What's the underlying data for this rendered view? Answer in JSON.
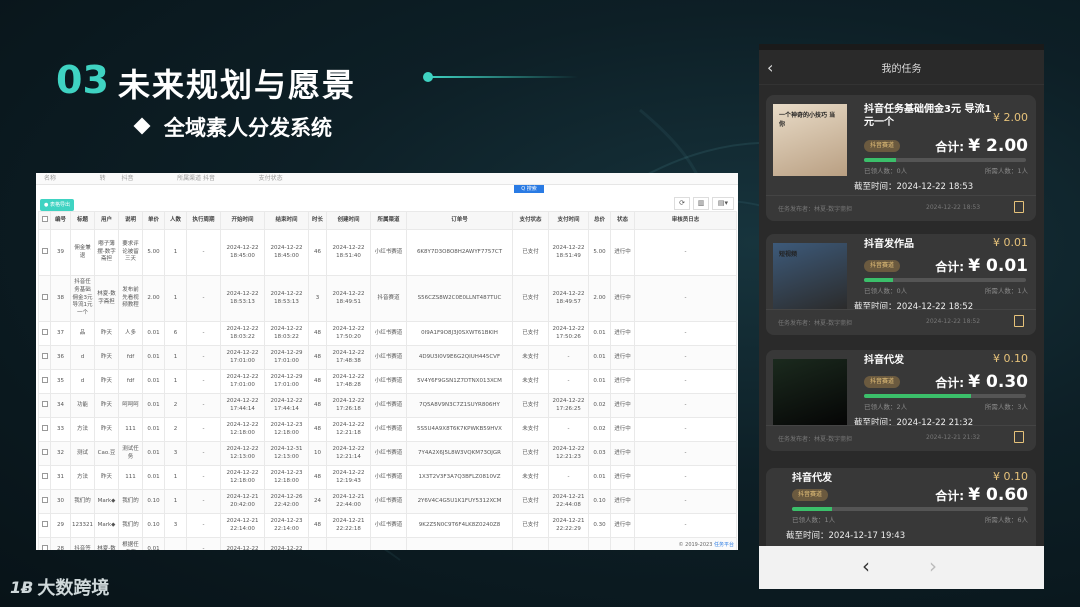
{
  "slide": {
    "section_number": "03",
    "section_title": "未来规划与愿景",
    "subtitle": "全域素人分发系统",
    "logo_text": "大数跨境",
    "logo_mark": "1Ƀ",
    "accent_color": "#3fd3c2"
  },
  "admin": {
    "topbar": "名称 　　 　　 　　 转 　　 抖音 　　 　　 　　 所属渠道 抖音 　　 　　 　　 支付状态 　　 　　 　　",
    "export_label": "● 表格导出",
    "search_label": "Q 搜索",
    "tool_refresh": "⟳",
    "tool_columns": "▥",
    "tool_export": "▤▾",
    "footer_text": "© 2019-2023",
    "footer_link": "任务平台",
    "columns": [
      "编号",
      "标题",
      "用户",
      "说明",
      "单价",
      "人数",
      "执行周期",
      "开始时间",
      "结束时间",
      "时长",
      "创建时间",
      "所属渠道",
      "订单号",
      "支付状态",
      "支付时间",
      "总价",
      "状态",
      "审核员日志"
    ],
    "rows": [
      {
        "tall": true,
        "cells": [
          "39",
          "佣金兼退",
          "嘟子薄摆-数字斋担",
          "要求评论被留三天",
          "5.00",
          "1",
          "-",
          "2024-12-22 18:45:00",
          "2024-12-22 18:45:00",
          "46",
          "2024-12-22 18:51:40",
          "小红书赛道",
          "6K8Y7D3O8O8H2AWYF7757CT",
          "已支付",
          "2024-12-22 18:51:49",
          "5.00",
          "进行中",
          "-"
        ]
      },
      {
        "tall": true,
        "cells": [
          "38",
          "抖音任务基础佣金3元导流1元一个",
          "林夏-数字斋担",
          "发布前先看视频教程",
          "2.00",
          "1",
          "-",
          "2024-12-22 18:53:13",
          "2024-12-22 18:53:13",
          "3",
          "2024-12-22 18:49:51",
          "抖音赛道",
          "S56CZS8W2C0E0LLNT487TUC",
          "已支付",
          "2024-12-22 18:49:57",
          "2.00",
          "进行中",
          "-"
        ]
      },
      {
        "tall": false,
        "cells": [
          "37",
          "品",
          "昨天",
          "人多",
          "0.01",
          "6",
          "-",
          "2024-12-22 18:03:22",
          "2024-12-22 18:03:22",
          "48",
          "2024-12-22 17:50:20",
          "小红书赛道",
          "0I9A1F9O8J3J0SXWT61BKIH",
          "已支付",
          "2024-12-22 17:50:26",
          "0.01",
          "进行中",
          "-"
        ]
      },
      {
        "tall": false,
        "cells": [
          "36",
          "d",
          "昨天",
          "fdf",
          "0.01",
          "1",
          "-",
          "2024-12-22 17:01:00",
          "2024-12-29 17:01:00",
          "48",
          "2024-12-22 17:48:38",
          "小红书赛道",
          "4D9U3I0V9E6G2QIUH445CVF",
          "未支付",
          "-",
          "0.01",
          "进行中",
          "-"
        ]
      },
      {
        "tall": false,
        "cells": [
          "35",
          "d",
          "昨天",
          "fdf",
          "0.01",
          "1",
          "-",
          "2024-12-22 17:01:00",
          "2024-12-29 17:01:00",
          "48",
          "2024-12-22 17:48:28",
          "小红书赛道",
          "5V4Y6F9GSN1Z7DTNX013XCM",
          "未支付",
          "-",
          "0.01",
          "进行中",
          "-"
        ]
      },
      {
        "tall": false,
        "cells": [
          "34",
          "功能",
          "昨天",
          "呵呵呵",
          "0.01",
          "2",
          "-",
          "2024-12-22 17:44:14",
          "2024-12-22 17:44:14",
          "48",
          "2024-12-22 17:26:18",
          "小红书赛道",
          "7Q5A8V9N3C7Z1SUYR806HY",
          "已支付",
          "2024-12-22 17:26:25",
          "0.02",
          "进行中",
          "-"
        ]
      },
      {
        "tall": false,
        "cells": [
          "33",
          "方法",
          "昨天",
          "111",
          "0.01",
          "2",
          "-",
          "2024-12-22 12:18:00",
          "2024-12-23 12:18:00",
          "48",
          "2024-12-22 12:21:18",
          "小红书赛道",
          "5S5U4A9X8T6K7KPWKB59HVX",
          "未支付",
          "-",
          "0.02",
          "进行中",
          "-"
        ]
      },
      {
        "tall": false,
        "cells": [
          "32",
          "测试",
          "Cao.豆",
          "测试任务",
          "0.01",
          "3",
          "-",
          "2024-12-22 12:13:00",
          "2024-12-31 12:13:00",
          "10",
          "2024-12-22 12:21:14",
          "小红书赛道",
          "7Y4A2X6J5L8W3VQKM73OJGR",
          "已支付",
          "2024-12-22 12:21:23",
          "0.03",
          "进行中",
          "-"
        ]
      },
      {
        "tall": false,
        "cells": [
          "31",
          "方法",
          "昨天",
          "111",
          "0.01",
          "1",
          "-",
          "2024-12-22 12:18:00",
          "2024-12-23 12:18:00",
          "48",
          "2024-12-22 12:19:43",
          "小红书赛道",
          "1X3T2V3F3A7Q3BFLZ0810VZ",
          "未支付",
          "-",
          "0.01",
          "进行中",
          "-"
        ]
      },
      {
        "tall": false,
        "cells": [
          "30",
          "我们的",
          "Mark◆",
          "我们的",
          "0.10",
          "1",
          "-",
          "2024-12-21 20:42:00",
          "2024-12-26 22:42:00",
          "24",
          "2024-12-21 22:44:00",
          "小红书赛道",
          "2Y6V4C4G5U1K1FUY5312XCM",
          "已支付",
          "2024-12-21 22:44:08",
          "0.10",
          "进行中",
          "-"
        ]
      },
      {
        "tall": false,
        "cells": [
          "29",
          "123321",
          "Mark◆",
          "我们的",
          "0.10",
          "3",
          "-",
          "2024-12-21 22:14:00",
          "2024-12-23 22:14:00",
          "48",
          "2024-12-21 22:22:18",
          "小红书赛道",
          "9K2Z5N0C9T6F4LK8Z0240Z8",
          "已支付",
          "2024-12-21 22:22:29",
          "0.30",
          "进行中",
          "-"
        ]
      },
      {
        "tall": false,
        "cells": [
          "28",
          "抖音签",
          "林夏-数",
          "根据任务要",
          "0.01",
          "",
          "-",
          "2024-12-22",
          "2024-12-22",
          "",
          "",
          "",
          "",
          "",
          "",
          "",
          "",
          ""
        ]
      }
    ]
  },
  "phone": {
    "nav_title": "我的任务",
    "back_icon": "‹",
    "pager_prev": "‹",
    "pager_next": "›",
    "cards": [
      {
        "title": "抖音任务基础佣金3元 导流1元一个",
        "price": "¥ 2.00",
        "tag": "抖音赛道",
        "total_label": "合计:",
        "total": "¥ 2.00",
        "progress": 0.2,
        "joined": "已领人数：0人",
        "needed": "所需人数：1人",
        "deadline": "截至时间：2024-12-22 18:53",
        "publisher": "任务发布者：林夏-数字斋担",
        "published": "2024-12-22 18:53",
        "thumb_text": "一个神奇的小技巧 当你"
      },
      {
        "title": "抖音发作品",
        "price": "¥ 0.01",
        "tag": "抖音赛道",
        "total_label": "合计:",
        "total": "¥ 0.01",
        "progress": 0.18,
        "joined": "已领人数：0人",
        "needed": "所需人数：1人",
        "deadline": "截至时间：2024-12-22 18:52",
        "publisher": "任务发布者：林夏-数字斋担",
        "published": "2024-12-22 18:52",
        "thumb_text": "短视频"
      },
      {
        "title": "抖音代发",
        "price": "¥ 0.10",
        "tag": "抖音赛道",
        "total_label": "合计:",
        "total": "¥ 0.30",
        "progress": 0.66,
        "joined": "已领人数：2人",
        "needed": "所需人数：3人",
        "deadline": "截至时间：2024-12-22 21:32",
        "publisher": "任务发布者：林夏-数字斋担",
        "published": "2024-12-21 21:32",
        "thumb_text": ""
      },
      {
        "title": "抖音代发",
        "price": "¥ 0.10",
        "tag": "抖音赛道",
        "total_label": "合计:",
        "total": "¥ 0.60",
        "progress": 0.17,
        "joined": "已领人数：1人",
        "needed": "所需人数：6人",
        "deadline": "截至时间：2024-12-17 19:43",
        "publisher": "",
        "published": "",
        "thumb_text": ""
      }
    ]
  }
}
